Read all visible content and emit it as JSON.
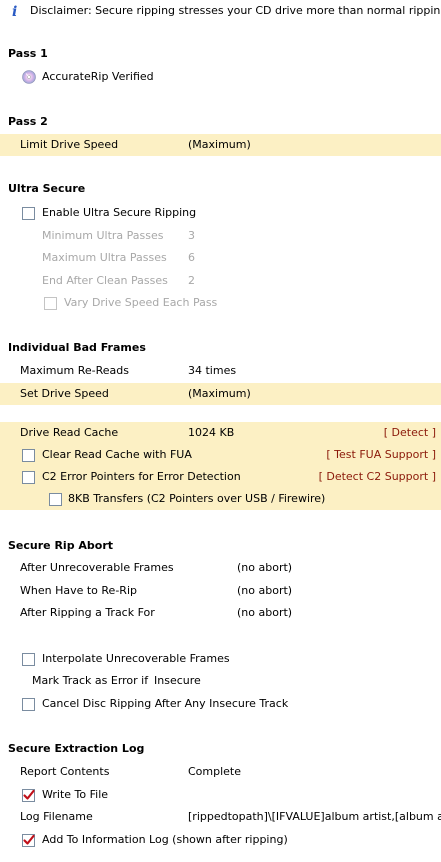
{
  "disclaimer": "Disclaimer: Secure ripping stresses your CD drive more than normal ripping",
  "pass1": {
    "heading": "Pass 1",
    "accuraterip": "AccurateRip Verified"
  },
  "pass2": {
    "heading": "Pass 2",
    "limit_label": "Limit Drive Speed",
    "limit_value": "(Maximum)"
  },
  "ultra": {
    "heading": "Ultra Secure",
    "enable_label": "Enable Ultra Secure Ripping",
    "enable_checked": false,
    "min_label": "Minimum Ultra Passes",
    "min_value": "3",
    "max_label": "Maximum Ultra Passes",
    "max_value": "6",
    "end_label": "End After Clean Passes",
    "end_value": "2",
    "vary_label": "Vary Drive Speed Each Pass"
  },
  "bad_frames": {
    "heading": "Individual Bad Frames",
    "rereads_label": "Maximum Re-Reads",
    "rereads_value": "34 times",
    "speed_label": "Set Drive Speed",
    "speed_value": "(Maximum)",
    "cache_label": "Drive Read Cache",
    "cache_value": "1024 KB",
    "cache_link": "[ Detect ]",
    "fua_label": "Clear Read Cache with FUA",
    "fua_link": "[ Test FUA Support ]",
    "c2_label": "C2 Error Pointers for Error Detection",
    "c2_link": "[ Detect C2 Support ]",
    "kb8_label": "8KB Transfers (C2 Pointers over USB / Firewire)"
  },
  "abort": {
    "heading": "Secure Rip Abort",
    "unrec_label": "After Unrecoverable Frames",
    "unrec_value": "(no abort)",
    "rerip_label": "When Have to Re-Rip",
    "rerip_value": "(no abort)",
    "track_label": "After Ripping a Track For",
    "track_value": "(no abort)",
    "interp_label": "Interpolate Unrecoverable Frames",
    "mark_label": "Mark Track as Error if",
    "mark_value": "Insecure",
    "cancel_label": "Cancel Disc Ripping After Any Insecure Track"
  },
  "log": {
    "heading": "Secure Extraction Log",
    "report_label": "Report Contents",
    "report_value": "Complete",
    "write_label": "Write To File",
    "write_checked": true,
    "filename_label": "Log Filename",
    "filename_value": "[rippedtopath]\\[IFVALUE]album artist,[album arti...",
    "addinfo_label": "Add To Information Log (shown after ripping)",
    "addinfo_checked": true
  },
  "colors": {
    "highlight": "#fcf0c4",
    "link": "#8b1a0a",
    "disabled": "#a8a8a8"
  }
}
